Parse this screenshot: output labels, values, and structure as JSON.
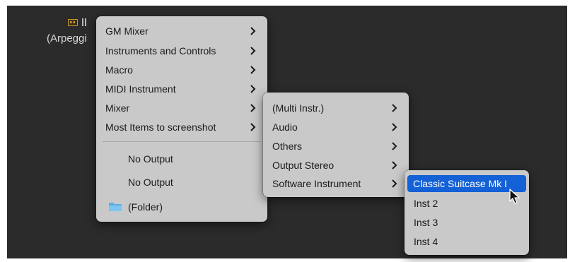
{
  "background": {
    "track_label": "(Arpeggi",
    "icon": "keyboard-instrument-icon"
  },
  "menu1": {
    "items": [
      {
        "label": "GM Mixer",
        "submenu": true
      },
      {
        "label": "Instruments and Controls",
        "submenu": true
      },
      {
        "label": "Macro",
        "submenu": true
      },
      {
        "label": "MIDI Instrument",
        "submenu": true
      },
      {
        "label": "Mixer",
        "submenu": true
      },
      {
        "label": "Most Items to screenshot",
        "submenu": true
      }
    ],
    "outputs": [
      "No Output",
      "No Output"
    ],
    "folder_label": "(Folder)",
    "folder_icon": "folder-icon"
  },
  "menu2": {
    "items": [
      {
        "label": "(Multi Instr.)",
        "submenu": true
      },
      {
        "label": "Audio",
        "submenu": true
      },
      {
        "label": "Others",
        "submenu": true
      },
      {
        "label": "Output Stereo",
        "submenu": true
      },
      {
        "label": "Software Instrument",
        "submenu": true
      }
    ]
  },
  "menu3": {
    "items": [
      {
        "label": "Classic Suitcase Mk I",
        "highlighted": true
      },
      {
        "label": "Inst 2"
      },
      {
        "label": "Inst 3"
      },
      {
        "label": "Inst 4"
      }
    ]
  },
  "colors": {
    "highlight": "#1460d6",
    "menu_bg": "#c9c9c9",
    "canvas_bg": "#2b2b2b"
  }
}
